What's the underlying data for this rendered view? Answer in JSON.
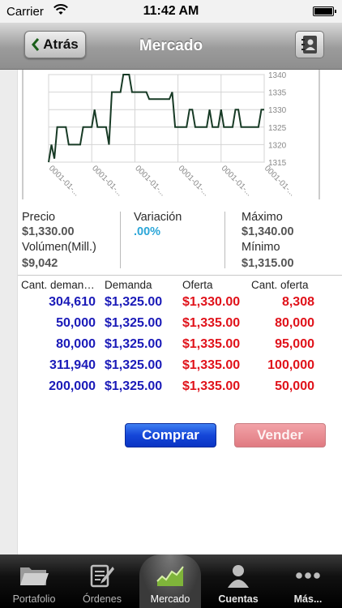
{
  "status_bar": {
    "carrier": "Carrier",
    "time": "11:42 AM"
  },
  "nav": {
    "back_label": "Atrás",
    "title": "Mercado"
  },
  "chart_data": {
    "type": "line",
    "y_ticks": [
      "1340",
      "1335",
      "1330",
      "1325",
      "1320",
      "1315"
    ],
    "x_tick_labels": [
      "0001-01-...",
      "0001-01-...",
      "0001-01-...",
      "0001-01-...",
      "0001-01-...",
      "0001-01-..."
    ],
    "ylim": [
      1315,
      1340
    ],
    "grid": true,
    "values": [
      1315,
      1320,
      1316,
      1325,
      1325,
      1325,
      1325,
      1320,
      1320,
      1320,
      1320,
      1320,
      1325,
      1325,
      1325,
      1325,
      1330,
      1325,
      1325,
      1325,
      1325,
      1320,
      1335,
      1335,
      1335,
      1335,
      1340,
      1340,
      1340,
      1335,
      1335,
      1335,
      1335,
      1335,
      1335,
      1333,
      1333,
      1333,
      1333,
      1333,
      1333,
      1333,
      1333,
      1335,
      1325,
      1325,
      1325,
      1325,
      1325,
      1330,
      1330,
      1325,
      1325,
      1325,
      1325,
      1325,
      1330,
      1325,
      1325,
      1325,
      1330,
      1325,
      1325,
      1325,
      1325,
      1330,
      1330,
      1325,
      1325,
      1325,
      1325,
      1325,
      1325,
      1325,
      1330,
      1330
    ],
    "line_color": "#173a25"
  },
  "info": {
    "precio_label": "Precio",
    "precio_value": "$1,330.00",
    "volumen_label": "Volúmen(Mill.)",
    "volumen_value": "$9,042",
    "variacion_label": "Variación",
    "variacion_value": ".00%",
    "maximo_label": "Máximo",
    "maximo_value": "$1,340.00",
    "minimo_label": "Mínimo",
    "minimo_value": "$1,315.00"
  },
  "book": {
    "headers": [
      "Cant. deman…",
      "Demanda",
      "Oferta",
      "Cant. oferta"
    ],
    "rows": [
      [
        "304,610",
        "$1,325.00",
        "$1,330.00",
        "8,308"
      ],
      [
        "50,000",
        "$1,325.00",
        "$1,335.00",
        "80,000"
      ],
      [
        "80,000",
        "$1,325.00",
        "$1,335.00",
        "95,000"
      ],
      [
        "311,940",
        "$1,325.00",
        "$1,335.00",
        "100,000"
      ],
      [
        "200,000",
        "$1,325.00",
        "$1,335.00",
        "50,000"
      ]
    ]
  },
  "actions": {
    "buy_label": "Comprar",
    "sell_label": "Vender"
  },
  "tabs": [
    {
      "label": "Portafolio",
      "icon": "folder-icon"
    },
    {
      "label": "Órdenes",
      "icon": "orders-icon"
    },
    {
      "label": "Mercado",
      "icon": "market-icon"
    },
    {
      "label": "Cuentas",
      "icon": "user-icon"
    },
    {
      "label": "Más...",
      "icon": "more-icon"
    }
  ],
  "colors": {
    "buy": "#1446d8",
    "sell": "#e07a81",
    "demand_text": "#1a1ab8",
    "offer_text": "#e0121a",
    "variation": "#2ba6d8"
  }
}
